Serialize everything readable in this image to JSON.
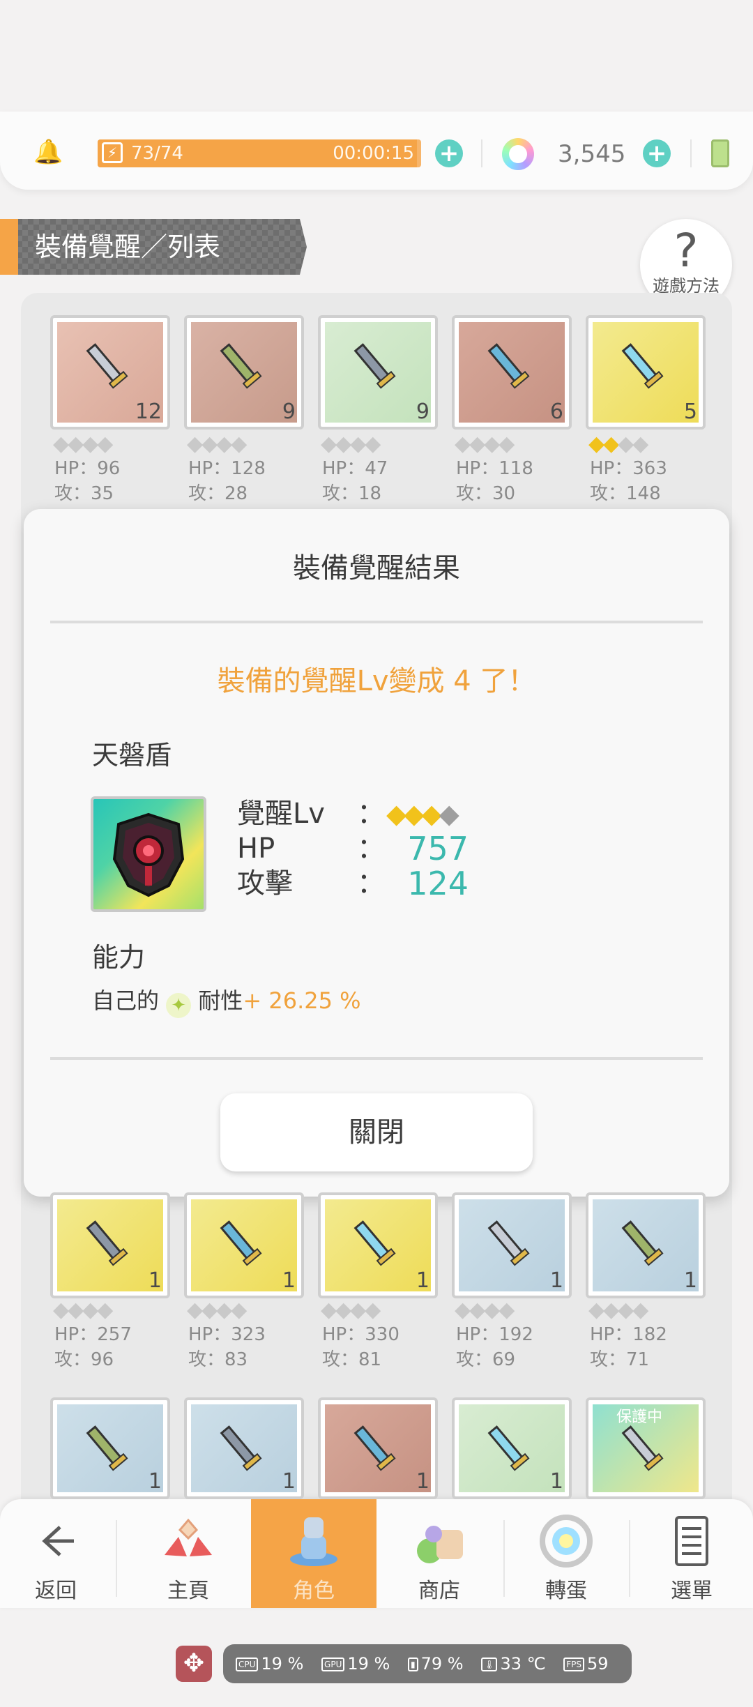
{
  "topbar": {
    "stamina_value": "73/74",
    "stamina_fraction": 0.986,
    "stamina_timer": "00:00:15",
    "gem_count": "3,545"
  },
  "header": {
    "title": "裝備覺醒／列表",
    "help_label": "遊戲方法"
  },
  "grid_top": [
    {
      "count": "12",
      "hp": "HP：96",
      "atk": "攻：35",
      "gold": 0
    },
    {
      "count": "9",
      "hp": "HP：128",
      "atk": "攻：28",
      "gold": 0
    },
    {
      "count": "9",
      "hp": "HP：47",
      "atk": "攻：18",
      "gold": 0
    },
    {
      "count": "6",
      "hp": "HP：118",
      "atk": "攻：30",
      "gold": 0
    },
    {
      "count": "5",
      "hp": "HP：363",
      "atk": "攻：148",
      "gold": 2
    }
  ],
  "grid_mid": [
    {
      "count": "1",
      "hp": "HP：257",
      "atk": "攻：96"
    },
    {
      "count": "1",
      "hp": "HP：323",
      "atk": "攻：83"
    },
    {
      "count": "1",
      "hp": "HP：330",
      "atk": "攻：81"
    },
    {
      "count": "1",
      "hp": "HP：192",
      "atk": "攻：69"
    },
    {
      "count": "1",
      "hp": "HP：182",
      "atk": "攻：71"
    }
  ],
  "grid_bottom": [
    {
      "count": "1",
      "tag": ""
    },
    {
      "count": "1",
      "tag": ""
    },
    {
      "count": "1",
      "tag": ""
    },
    {
      "count": "1",
      "tag": ""
    },
    {
      "count": "",
      "tag": "保護中"
    }
  ],
  "modal": {
    "title": "裝備覺醒結果",
    "message": "裝備的覺醒Lv變成 4 了！",
    "item_name": "天磐盾",
    "awaken_label": "覺醒Lv",
    "awaken_level": 3,
    "awaken_max": 4,
    "hp_label": "HP",
    "hp_value": "757",
    "atk_label": "攻擊",
    "atk_value": "124",
    "colon": "：",
    "ability_title": "能力",
    "ability_prefix": "自己的",
    "ability_suffix": "耐性",
    "ability_value": "+ 26.25 %",
    "close_label": "關閉"
  },
  "nav": {
    "back": "返回",
    "home": "主頁",
    "character": "角色",
    "shop": "商店",
    "gacha": "轉蛋",
    "menu": "選單"
  },
  "perf": {
    "cpu": "19 %",
    "gpu": "19 %",
    "battery": "79 %",
    "temp": "33 ℃",
    "fps": "59"
  },
  "colors": {
    "accent": "#f5a447",
    "teal": "#3bb8ad",
    "gold": "#f1c21b"
  }
}
